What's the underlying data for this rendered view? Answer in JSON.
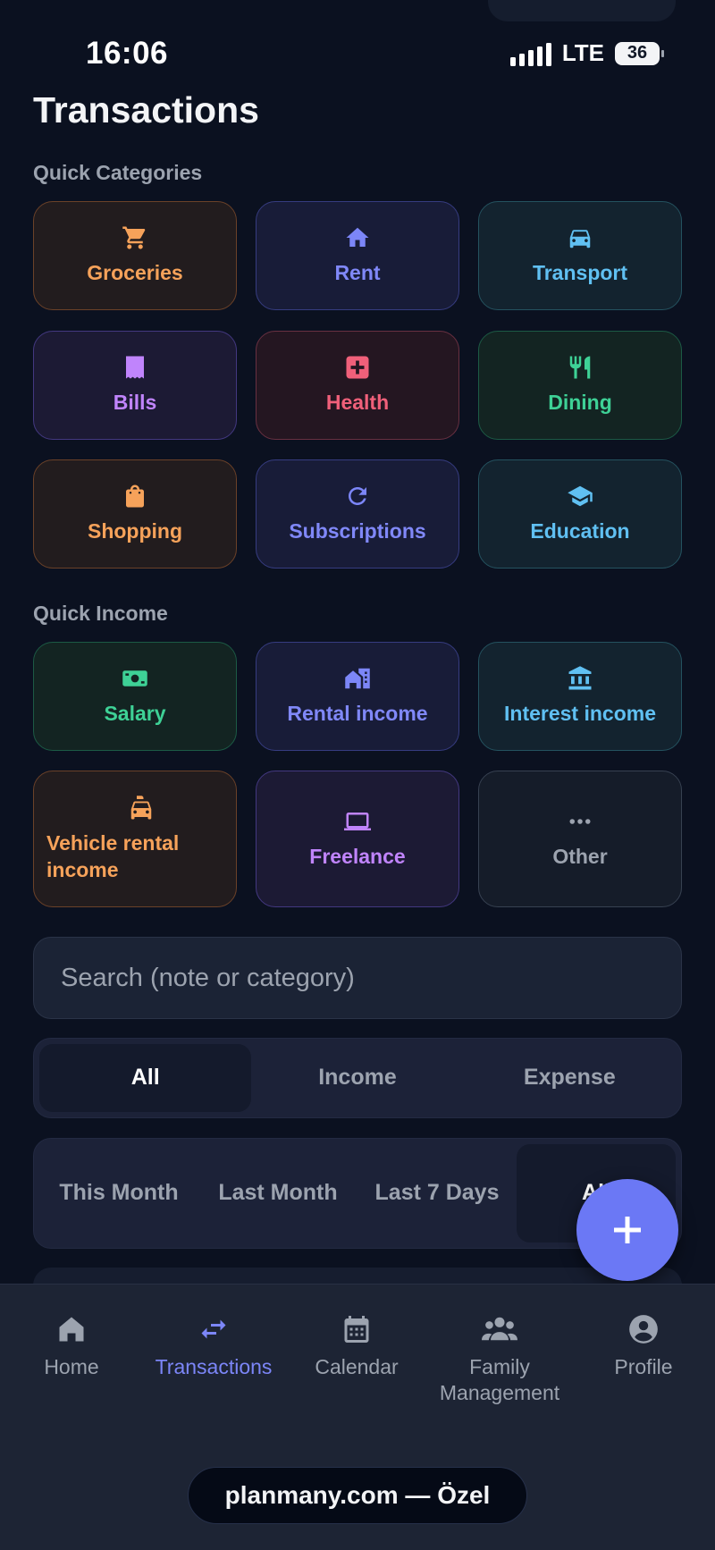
{
  "status_bar": {
    "time": "16:06",
    "network": "LTE",
    "battery": "36"
  },
  "page": {
    "title": "Transactions"
  },
  "quick_categories": {
    "label": "Quick Categories",
    "items": [
      {
        "label": "Groceries",
        "icon": "cart-icon",
        "color": "#f6a25a"
      },
      {
        "label": "Rent",
        "icon": "home-icon",
        "color": "#8088f8"
      },
      {
        "label": "Transport",
        "icon": "car-icon",
        "color": "#60c0f2"
      },
      {
        "label": "Bills",
        "icon": "receipt-icon",
        "color": "#c084fc"
      },
      {
        "label": "Health",
        "icon": "medical-icon",
        "color": "#f0607a"
      },
      {
        "label": "Dining",
        "icon": "utensils-icon",
        "color": "#3ed196"
      },
      {
        "label": "Shopping",
        "icon": "shopping-bag-icon",
        "color": "#f6a25a"
      },
      {
        "label": "Subscriptions",
        "icon": "refresh-icon",
        "color": "#8088f8"
      },
      {
        "label": "Education",
        "icon": "graduation-cap-icon",
        "color": "#60c0f2"
      }
    ]
  },
  "quick_income": {
    "label": "Quick Income",
    "items": [
      {
        "label": "Salary",
        "icon": "cash-icon",
        "color": "#3ed196"
      },
      {
        "label": "Rental income",
        "icon": "building-icon",
        "color": "#8088f8"
      },
      {
        "label": "Interest income",
        "icon": "bank-icon",
        "color": "#60c0f2"
      },
      {
        "label": "Vehicle rental income",
        "icon": "taxi-icon",
        "color": "#f6a25a"
      },
      {
        "label": "Freelance",
        "icon": "laptop-icon",
        "color": "#c084fc"
      },
      {
        "label": "Other",
        "icon": "more-horizontal-icon",
        "color": "#9ca3af"
      }
    ]
  },
  "search": {
    "placeholder": "Search (note or category)"
  },
  "type_filter": {
    "options": [
      "All",
      "Income",
      "Expense"
    ],
    "selected": "All"
  },
  "period_filter": {
    "options": [
      "This Month",
      "Last Month",
      "Last 7 Days",
      "All"
    ],
    "selected": "All"
  },
  "bottom_nav": {
    "items": [
      {
        "label": "Home",
        "icon": "home-icon"
      },
      {
        "label": "Transactions",
        "icon": "swap-arrows-icon",
        "active": true
      },
      {
        "label": "Calendar",
        "icon": "calendar-icon"
      },
      {
        "label": "Family Management",
        "icon": "users-icon"
      },
      {
        "label": "Profile",
        "icon": "profile-icon"
      }
    ]
  },
  "browser": {
    "url_text": "planmany.com — Özel"
  }
}
